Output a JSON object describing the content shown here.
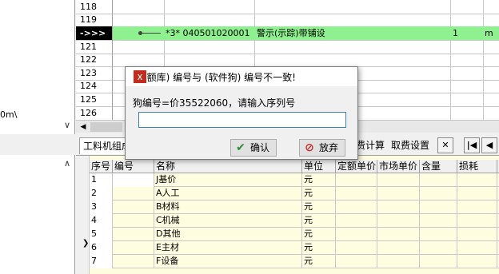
{
  "left_panel": {
    "path_text": "0m\\"
  },
  "top_grid": {
    "rows": [
      {
        "no": "118"
      },
      {
        "no": "119"
      },
      {
        "no": "->>>",
        "current": true,
        "code": "*3* 040501020001",
        "name": "警示(示踪)带铺设",
        "qty": "1",
        "unit": "m"
      },
      {
        "no": "121"
      },
      {
        "no": "122"
      },
      {
        "no": "123"
      },
      {
        "no": "124"
      },
      {
        "no": "125"
      },
      {
        "no": "126"
      }
    ]
  },
  "tabs": {
    "items": [
      "工料机组成",
      "费计算",
      "取费设置"
    ]
  },
  "bottom_grid": {
    "headers": [
      "序号",
      "编号",
      "名称",
      "单位",
      "定额单价",
      "市场单价",
      "含量",
      "损耗"
    ],
    "rows": [
      {
        "no": "1",
        "name": "J基价",
        "unit": "元"
      },
      {
        "no": "2",
        "name": "A人工",
        "unit": "元"
      },
      {
        "no": "3",
        "name": "B材料",
        "unit": "元"
      },
      {
        "no": "4",
        "name": "C机械",
        "unit": "元"
      },
      {
        "no": "5",
        "name": "D其他",
        "unit": "元"
      },
      {
        "no": "6",
        "name": "E主材",
        "unit": "元"
      },
      {
        "no": "7",
        "name": "F设备",
        "unit": "元"
      }
    ]
  },
  "dialog": {
    "title": "(定额库) 编号与 (软件狗) 编号不一致!",
    "close": "x",
    "prompt": "狗编号=价35522060，请输入序列号",
    "input_value": "",
    "ok_label": "确认",
    "cancel_label": "放弃"
  }
}
